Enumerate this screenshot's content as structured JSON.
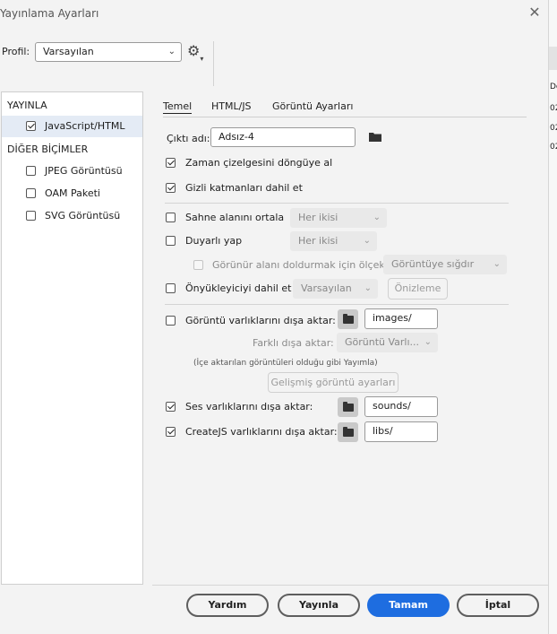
{
  "window": {
    "title": "Yayınlama Ayarları",
    "close_glyph": "✕"
  },
  "profile": {
    "label": "Profil:",
    "value": "Varsayılan"
  },
  "background_fragment": {
    "items": [
      "De",
      "02",
      "02",
      "02"
    ]
  },
  "sidebar": {
    "section_publish": "YAYINLA",
    "section_other": "DİĞER BİÇİMLER",
    "items": [
      {
        "label": "JavaScript/HTML",
        "checked": true,
        "selected": true
      },
      {
        "label": "JPEG Görüntüsü",
        "checked": false
      },
      {
        "label": "OAM Paketi",
        "checked": false
      },
      {
        "label": "SVG Görüntüsü",
        "checked": false
      }
    ]
  },
  "tabs": [
    "Temel",
    "HTML/JS",
    "Görüntü Ayarları"
  ],
  "basic": {
    "output_label": "Çıktı adı:",
    "output_value": "Adsız-4",
    "loop_timeline": "Zaman çizelgesini döngüye al",
    "include_hidden": "Gizli katmanları dahil et",
    "center_stage": "Sahne alanını ortala",
    "center_stage_value": "Her ikisi",
    "responsive": "Duyarlı yap",
    "responsive_value": "Her ikisi",
    "scale_fill": "Görünür alanı doldurmak için ölçekle",
    "scale_fill_value": "Görüntüye sığdır",
    "preloader": "Önyükleyiciyi dahil et",
    "preloader_value": "Varsayılan",
    "preview_button": "Önizleme",
    "export_images": "Görüntü varlıklarını dışa aktar:",
    "images_path": "images/",
    "export_as_label": "Farklı dışa aktar:",
    "export_as_value": "Görüntü Varlı...",
    "imported_note": "(İçe aktarılan görüntüleri olduğu gibi Yayımla)",
    "advanced_image_button": "Gelişmiş görüntü ayarları",
    "export_sounds": "Ses varlıklarını dışa aktar:",
    "sounds_path": "sounds/",
    "export_createjs": "CreateJS varlıklarını dışa aktar:",
    "libs_path": "libs/"
  },
  "footer": {
    "help": "Yardım",
    "publish": "Yayınla",
    "ok": "Tamam",
    "cancel": "İptal"
  }
}
